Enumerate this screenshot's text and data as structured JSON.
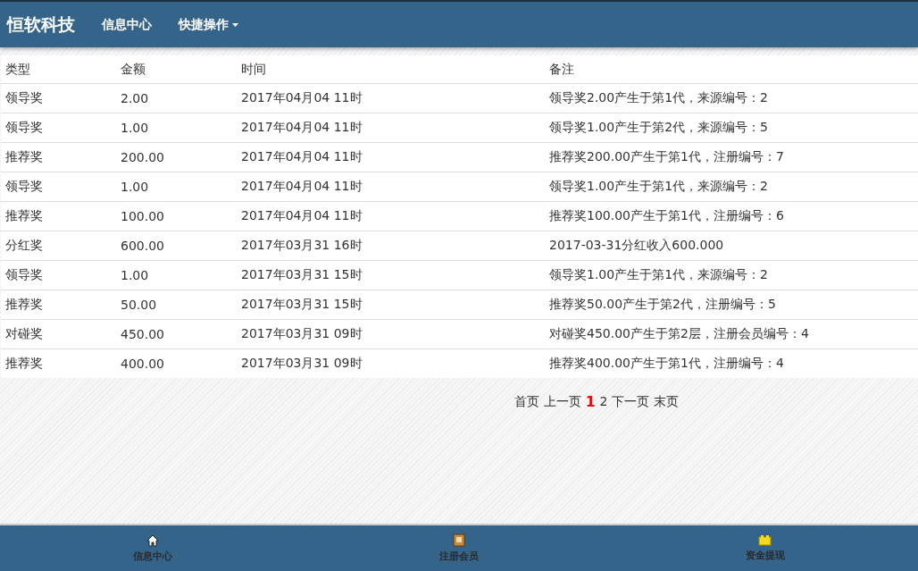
{
  "navbar": {
    "brand": "恒软科技",
    "items": [
      {
        "label": "信息中心",
        "kind": "link"
      },
      {
        "label": "快捷操作",
        "kind": "dropdown"
      }
    ]
  },
  "table": {
    "columns": [
      "类型",
      "金额",
      "时间",
      "备注"
    ],
    "rows": [
      [
        "领导奖",
        "2.00",
        "2017年04月04 11时",
        "领导奖2.00产生于第1代，来源编号：2"
      ],
      [
        "领导奖",
        "1.00",
        "2017年04月04 11时",
        "领导奖1.00产生于第2代，来源编号：5"
      ],
      [
        "推荐奖",
        "200.00",
        "2017年04月04 11时",
        "推荐奖200.00产生于第1代，注册编号：7"
      ],
      [
        "领导奖",
        "1.00",
        "2017年04月04 11时",
        "领导奖1.00产生于第1代，来源编号：2"
      ],
      [
        "推荐奖",
        "100.00",
        "2017年04月04 11时",
        "推荐奖100.00产生于第1代，注册编号：6"
      ],
      [
        "分红奖",
        "600.00",
        "2017年03月31 16时",
        "2017-03-31分红收入600.000"
      ],
      [
        "领导奖",
        "1.00",
        "2017年03月31 15时",
        "领导奖1.00产生于第1代，来源编号：2"
      ],
      [
        "推荐奖",
        "50.00",
        "2017年03月31 15时",
        "推荐奖50.00产生于第2代，注册编号：5"
      ],
      [
        "对碰奖",
        "450.00",
        "2017年03月31 09时",
        "对碰奖450.00产生于第2层，注册会员编号：4"
      ],
      [
        "推荐奖",
        "400.00",
        "2017年03月31 09时",
        "推荐奖400.00产生于第1代，注册编号：4"
      ]
    ]
  },
  "pagination": {
    "first": "首页",
    "prev": "上一页",
    "pages": [
      {
        "label": "1",
        "selected": true
      },
      {
        "label": "2",
        "selected": false
      }
    ],
    "next": "下一页",
    "last": "末页"
  },
  "bottom_nav": [
    {
      "label": "信息中心",
      "kind": "home"
    },
    {
      "label": "注册会员",
      "kind": "book"
    },
    {
      "label": "资金提现",
      "kind": "box"
    }
  ]
}
